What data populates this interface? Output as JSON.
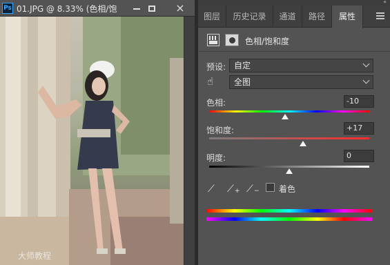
{
  "document": {
    "app_icon": "Ps",
    "title": "01.JPG @ 8.33% (色相/饱",
    "controls": {
      "minimize": "minimize-icon",
      "maximize": "maximize-icon",
      "close": "×"
    }
  },
  "panel": {
    "tabs": [
      {
        "label": "图层"
      },
      {
        "label": "历史记录"
      },
      {
        "label": "通道"
      },
      {
        "label": "路径"
      },
      {
        "label": "属性"
      }
    ],
    "active_tab": "属性",
    "menu_icon": "hamburger-menu-icon",
    "adjustment_title": "色相/饱和度",
    "preset_label": "预设:",
    "preset_value": "自定",
    "channel_value": "全图",
    "hue": {
      "label": "色相:",
      "value": "-10",
      "numeric": -10
    },
    "saturation": {
      "label": "饱和度:",
      "value": "+17",
      "numeric": 17
    },
    "lightness": {
      "label": "明度:",
      "value": "0",
      "numeric": 0
    },
    "colorize_label": "着色",
    "colorize_checked": false
  },
  "watermark": "大师教程"
}
